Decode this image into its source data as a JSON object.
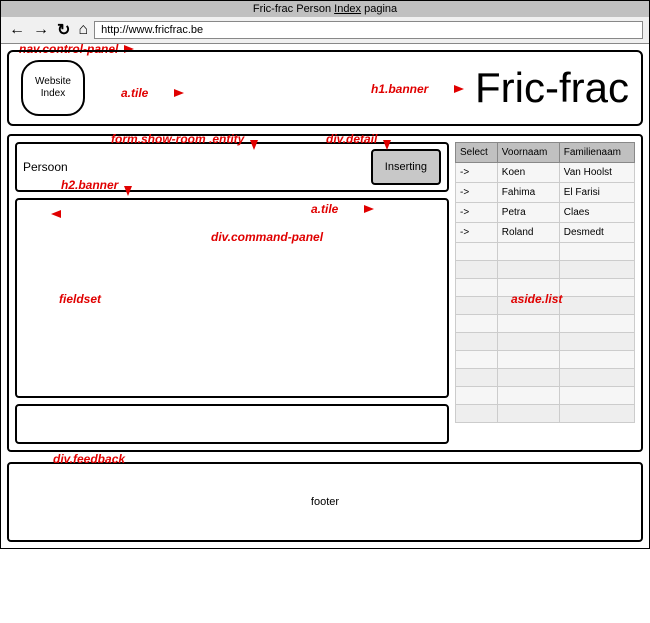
{
  "browser": {
    "title_pre": "Fric-frac Person ",
    "title_u": "Index",
    "title_post": " pagina",
    "url": "http://www.fricfrac.be"
  },
  "nav": {
    "websiteIndex": "Website Index",
    "siteTitle": "Fric-frac"
  },
  "detail": {
    "h2": "Persoon",
    "insertBtn": "Inserting"
  },
  "table": {
    "headers": {
      "select": "Select",
      "first": "Voornaam",
      "last": "Familienaam"
    },
    "rows": [
      {
        "sel": "->",
        "first": "Koen",
        "last": "Van Hoolst"
      },
      {
        "sel": "->",
        "first": "Fahima",
        "last": "El Farisi"
      },
      {
        "sel": "->",
        "first": "Petra",
        "last": "Claes"
      },
      {
        "sel": "->",
        "first": "Roland",
        "last": "Desmedt"
      }
    ]
  },
  "footer": "footer",
  "annotations": {
    "navControlPanel": "nav.control-panel",
    "aTile1": "a.tile",
    "h1banner": "h1.banner",
    "formShowRoom": "form.show-room .entity",
    "divDetail": "div.detail",
    "h2banner": "h2.banner",
    "aTile2": "a.tile",
    "divCommandPanel": "div.command-panel",
    "fieldset": "fieldset",
    "divFeedback": "div.feedback",
    "asideList": "aside.list"
  }
}
